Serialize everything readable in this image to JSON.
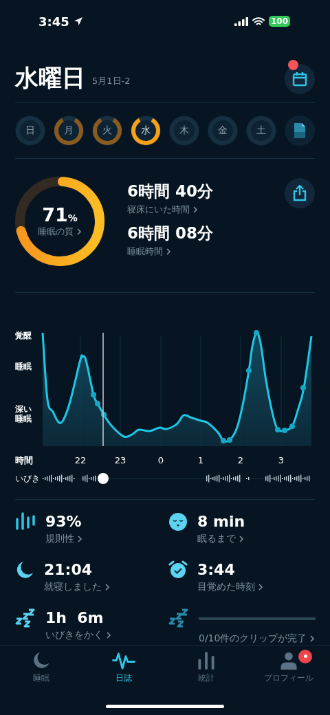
{
  "status_bar": {
    "time": "3:45",
    "battery": "100"
  },
  "header": {
    "title": "水曜日",
    "date": "5月1日-2",
    "calendar_badge": true
  },
  "days": [
    {
      "kind": "day",
      "label": "日",
      "recorded": false,
      "selected": false
    },
    {
      "kind": "day",
      "label": "月",
      "recorded": true,
      "selected": false
    },
    {
      "kind": "day",
      "label": "火",
      "recorded": true,
      "selected": false
    },
    {
      "kind": "day",
      "label": "水",
      "recorded": true,
      "selected": true
    },
    {
      "kind": "day",
      "label": "木",
      "recorded": false,
      "selected": false
    },
    {
      "kind": "day",
      "label": "金",
      "recorded": false,
      "selected": false
    },
    {
      "kind": "day",
      "label": "土",
      "recorded": false,
      "selected": false
    },
    {
      "kind": "report",
      "selected": false
    }
  ],
  "summary": {
    "quality": {
      "value": "71",
      "unit": "%",
      "label": "睡眠の質"
    },
    "durations": [
      {
        "value": "6時間 40分",
        "label": "寝床にいた時間"
      },
      {
        "value": "6時間 08分",
        "label": "睡眠時間"
      }
    ]
  },
  "chart": {
    "y_labels": [
      "覚醒",
      "睡眠",
      "深い睡眠"
    ],
    "axis_title": "時間",
    "x_labels": [
      "22",
      "23",
      "0",
      "1",
      "2",
      "3"
    ]
  },
  "snore_track": {
    "label": "いびき"
  },
  "stats": [
    {
      "kind": "regularity",
      "value": "93%",
      "label": "規則性"
    },
    {
      "kind": "latency",
      "value": "8 min",
      "label": "眠るまで"
    },
    {
      "kind": "bedtime",
      "value": "21:04",
      "label": "就寝しました"
    },
    {
      "kind": "wake",
      "value": "3:44",
      "label": "目覚めた時刻"
    },
    {
      "kind": "snoring",
      "value": "1h  6m",
      "label": "いびきをかく"
    },
    {
      "kind": "clips",
      "label": "0/10件のクリップが完了",
      "level": 0
    }
  ],
  "tabs": [
    {
      "kind": "sleep",
      "label": "睡眠",
      "selected": false,
      "badge": false
    },
    {
      "kind": "journal",
      "label": "日誌",
      "selected": true,
      "badge": false
    },
    {
      "kind": "stats",
      "label": "統計",
      "selected": false,
      "badge": false
    },
    {
      "kind": "profile",
      "label": "プロフィール",
      "selected": false,
      "badge": true
    }
  ]
}
